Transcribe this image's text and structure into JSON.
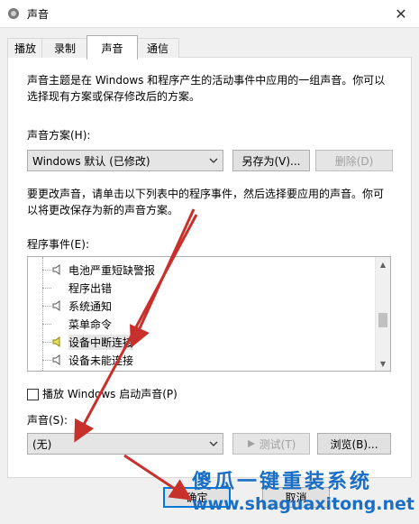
{
  "window": {
    "title": "声音",
    "close_glyph": "✕"
  },
  "tabs": [
    {
      "label": "播放"
    },
    {
      "label": "录制"
    },
    {
      "label": "声音",
      "active": true
    },
    {
      "label": "通信"
    }
  ],
  "intro_text_line1": "声音主题是在 Windows 和程序产生的活动事件中应用的一组声音。你可以",
  "intro_text_line2": "选择现有方案或保存修改后的方案。",
  "scheme": {
    "label": "声音方案(H):",
    "selected": "Windows 默认 (已修改)",
    "save_as_label": "另存为(V)...",
    "delete_label": "删除(D)"
  },
  "change_text_line1": "要更改声音，请单击以下列表中的程序事件，然后选择要应用的声音。你可",
  "change_text_line2": "以将更改保存为新的声音方案。",
  "events": {
    "label": "程序事件(E):",
    "items": [
      {
        "label": "电池严重短缺警报",
        "has_sound": true,
        "selected": false
      },
      {
        "label": "程序出错",
        "has_sound": false,
        "selected": false
      },
      {
        "label": "系统通知",
        "has_sound": true,
        "selected": false
      },
      {
        "label": "菜单命令",
        "has_sound": false,
        "selected": false
      },
      {
        "label": "设备中断连接",
        "has_sound": true,
        "selected": true
      },
      {
        "label": "设备未能连接",
        "has_sound": true,
        "selected": false
      }
    ]
  },
  "startup_sound": {
    "label": "播放 Windows 启动声音(P)",
    "checked": false
  },
  "sound": {
    "label": "声音(S):",
    "selected": "(无)",
    "test_label": "测试(T)",
    "browse_label": "浏览(B)..."
  },
  "footer": {
    "ok_label": "确定",
    "cancel_label": "取消"
  },
  "watermark": {
    "line1": "傻瓜一键重装系统",
    "line2": "www.shaguaxitong.net"
  },
  "colors": {
    "arrow": "#c8302c",
    "watermark": "#1a6fc4",
    "focus": "#0078d7",
    "speaker": "#b8b000"
  }
}
